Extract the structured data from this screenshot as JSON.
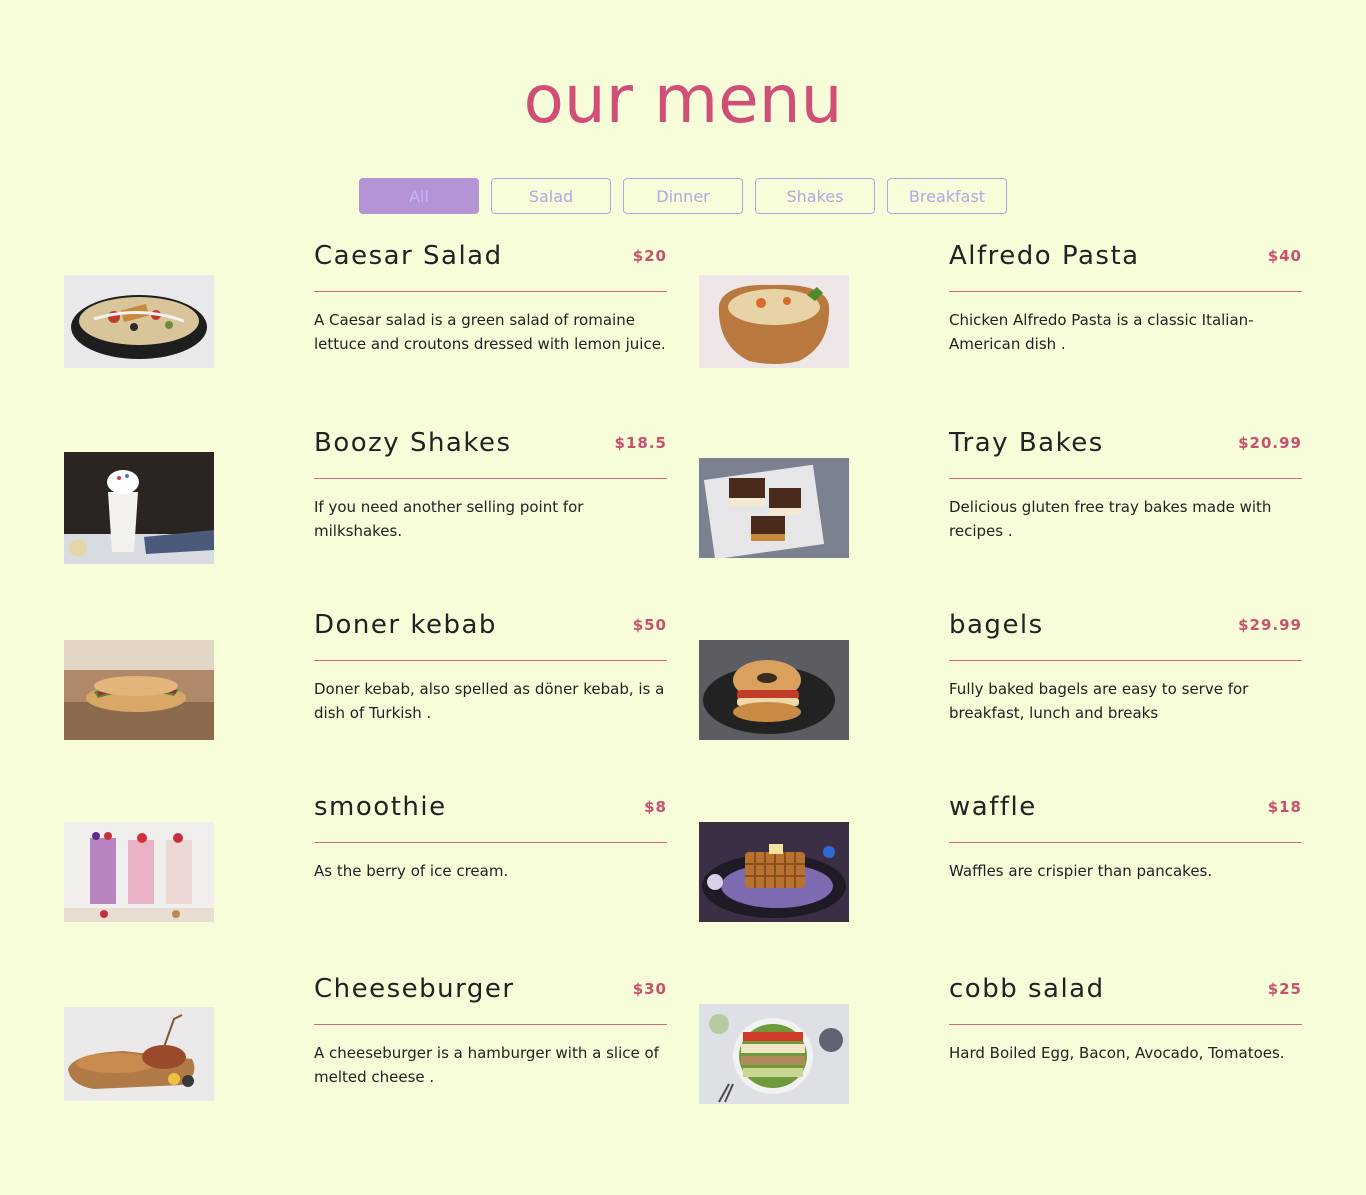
{
  "title": "our menu",
  "filters": [
    "All",
    "Salad",
    "Dinner",
    "Shakes",
    "Breakfast"
  ],
  "active_filter": "All",
  "colors": {
    "background": "#f7fdd9",
    "accent": "#d04f77",
    "filter_border": "#b8a4e6",
    "filter_active_bg": "#b594d6"
  },
  "items": [
    {
      "name": "Caesar Salad",
      "price": "$20",
      "desc": "A Caesar salad is a green salad of romaine lettuce and croutons dressed with lemon juice.",
      "image": "caesar-salad-photo"
    },
    {
      "name": "Alfredo Pasta",
      "price": "$40",
      "desc": "Chicken Alfredo Pasta is a classic Italian-American dish .",
      "image": "alfredo-pasta-photo"
    },
    {
      "name": "Boozy Shakes",
      "price": "$18.5",
      "desc": "If you need another selling point for milkshakes.",
      "image": "boozy-shake-photo"
    },
    {
      "name": "Tray Bakes",
      "price": "$20.99",
      "desc": "Delicious gluten free tray bakes made with recipes .",
      "image": "tray-bakes-photo"
    },
    {
      "name": "Doner kebab",
      "price": "$50",
      "desc": "Doner kebab, also spelled as döner kebab, is a dish of Turkish .",
      "image": "doner-kebab-photo"
    },
    {
      "name": "bagels",
      "price": "$29.99",
      "desc": "Fully baked bagels are easy to serve for breakfast, lunch and breaks",
      "image": "bagel-photo"
    },
    {
      "name": "smoothie",
      "price": "$8",
      "desc": "As the berry of ice cream.",
      "image": "smoothie-photo"
    },
    {
      "name": "waffle",
      "price": "$18",
      "desc": "Waffles are crispier than pancakes.",
      "image": "waffle-photo"
    },
    {
      "name": "Cheeseburger",
      "price": "$30",
      "desc": "A cheeseburger is a hamburger with a slice of melted cheese .",
      "image": "cheeseburger-photo"
    },
    {
      "name": "cobb salad",
      "price": "$25",
      "desc": "Hard Boiled Egg, Bacon, Avocado, Tomatoes.",
      "image": "cobb-salad-photo"
    }
  ]
}
